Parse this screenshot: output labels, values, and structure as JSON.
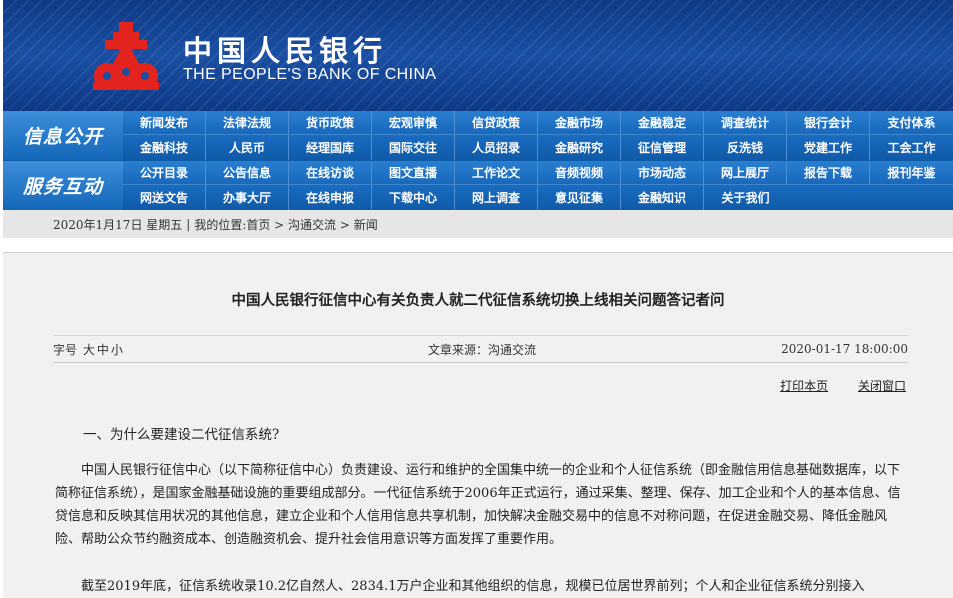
{
  "header": {
    "cn_name": "中国人民银行",
    "en_name": "THE PEOPLE'S BANK OF CHINA",
    "logo_icon": "pboc-logo-icon",
    "colors": {
      "header_bg": "#1a4fa3",
      "logo_red": "#e3231d"
    }
  },
  "nav": {
    "info_label": "信息公开",
    "service_label": "服务互动",
    "info_row1": [
      "新闻发布",
      "法律法规",
      "货币政策",
      "宏观审慎",
      "信贷政策",
      "金融市场",
      "金融稳定",
      "调查统计",
      "银行会计",
      "支付体系"
    ],
    "info_row2": [
      "金融科技",
      "人民币",
      "经理国库",
      "国际交往",
      "人员招录",
      "金融研究",
      "征信管理",
      "反洗钱",
      "党建工作",
      "工会工作"
    ],
    "service_row1": [
      "公开目录",
      "公告信息",
      "在线访谈",
      "图文直播",
      "工作论文",
      "音频视频",
      "市场动态",
      "网上展厅",
      "报告下载",
      "报刊年鉴"
    ],
    "service_row2": [
      "网送文告",
      "办事大厅",
      "在线申报",
      "下载中心",
      "网上调查",
      "意见征集",
      "金融知识",
      "关于我们"
    ]
  },
  "breadcrumb": {
    "date": "2020年1月17日 星期五",
    "sep": "|",
    "location": "我的位置:首页 > 沟通交流 > 新闻"
  },
  "article": {
    "title": "中国人民银行征信中心有关负责人就二代征信系统切换上线相关问题答记者问",
    "font_size_label": "字号",
    "font_sizes": [
      "大",
      "中",
      "小"
    ],
    "source": "文章来源：沟通交流",
    "datetime": "2020-01-17 18:00:00",
    "print_label": "打印本页",
    "close_label": "关闭窗口",
    "heading1": "一、为什么要建设二代征信系统?",
    "para1": "中国人民银行征信中心（以下简称征信中心）负责建设、运行和维护的全国集中统一的企业和个人征信系统（即金融信用信息基础数据库，以下简称征信系统），是国家金融基础设施的重要组成部分。一代征信系统于2006年正式运行，通过采集、整理、保存、加工企业和个人的基本信息、信贷信息和反映其信用状况的其他信息，建立企业和个人信用信息共享机制，加快解决金融交易中的信息不对称问题，在促进金融交易、降低金融风险、帮助公众节约融资成本、创造融资机会、提升社会信用意识等方面发挥了重要作用。",
    "para2": "截至2019年底，征信系统收录10.2亿自然人、2834.1万户企业和其他组织的信息，规模已位居世界前列；个人和企业征信系统分别接入"
  }
}
